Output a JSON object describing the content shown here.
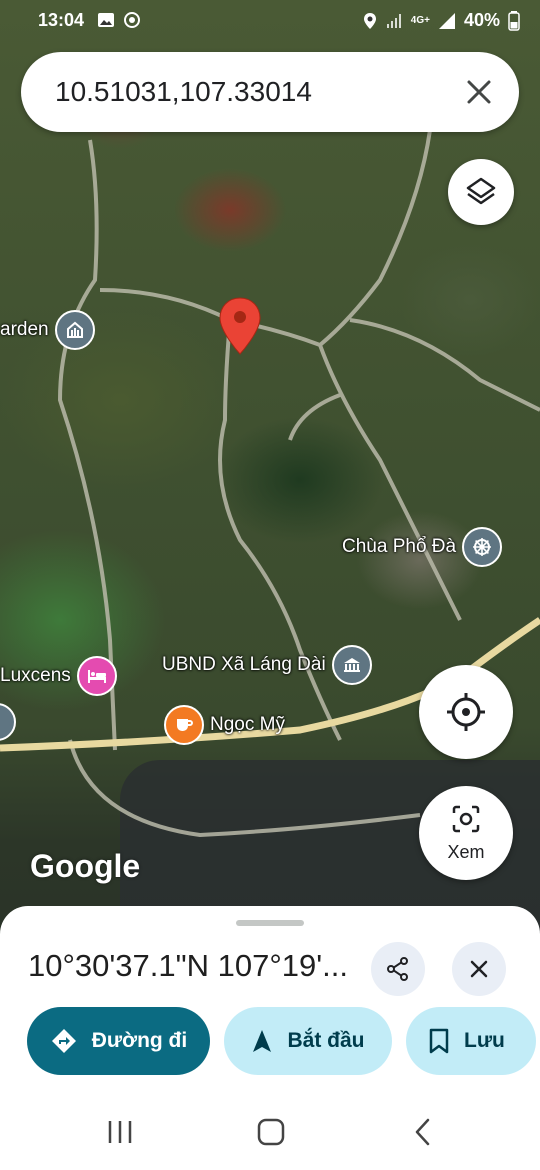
{
  "status_bar": {
    "time": "13:04",
    "network": "4G+",
    "battery": "40%"
  },
  "search": {
    "query": "10.51031,107.33014"
  },
  "map": {
    "pois": [
      {
        "label": "arden",
        "icon": "landmark-icon",
        "color": "#5f7582"
      },
      {
        "label": "Chùa Phổ Đà",
        "icon": "dharma-wheel-icon",
        "color": "#5f7582"
      },
      {
        "label": "UBND Xã Láng Dài",
        "icon": "government-building-icon",
        "color": "#5f7582"
      },
      {
        "label": "Luxcens",
        "icon": "hotel-bed-icon",
        "color": "#e44bb0"
      },
      {
        "label": "Ngọc Mỹ",
        "icon": "coffee-cup-icon",
        "color": "#f37a22"
      }
    ],
    "logo": "Google",
    "pin_color": "#ea4335"
  },
  "controls": {
    "xem_label": "Xem"
  },
  "sheet": {
    "coordinates": "10°30'37.1\"N 107°19'...",
    "directions_label": "Đường đi",
    "start_label": "Bắt đầu",
    "save_label": "Lưu"
  },
  "colors": {
    "accent": "#0b6b82",
    "tonal": "#c2ecf7"
  }
}
